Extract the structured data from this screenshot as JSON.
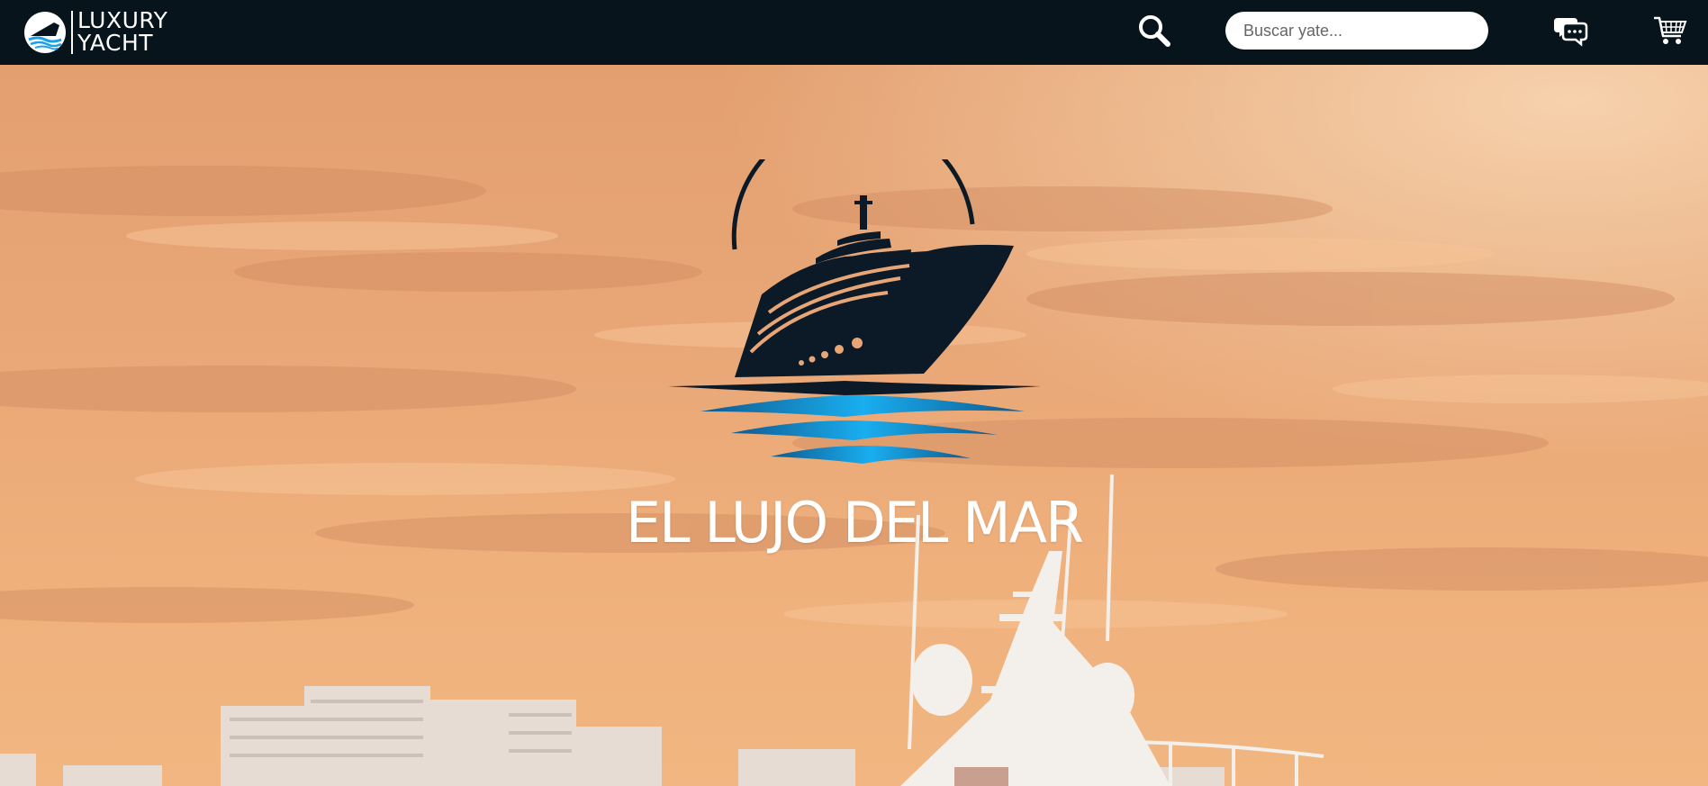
{
  "brand": {
    "line1": "LUXURY",
    "line2": "YACHT",
    "logo_icon": "yacht-circle-logo-icon"
  },
  "nav": {
    "search_icon": "search-icon",
    "search_placeholder": "Buscar yate...",
    "search_value": "",
    "chat_icon": "chat-bubbles-icon",
    "cart_icon": "shopping-cart-icon"
  },
  "hero": {
    "title": "EL LUJO DEL MAR",
    "emblem_icon": "yacht-waves-emblem-icon"
  },
  "colors": {
    "navbar_bg": "#07141b",
    "sky_top": "#e7a070",
    "sky_bottom": "#f3b882",
    "emblem_dark": "#0c1a28",
    "wave_blue": "#1aa0e6"
  }
}
